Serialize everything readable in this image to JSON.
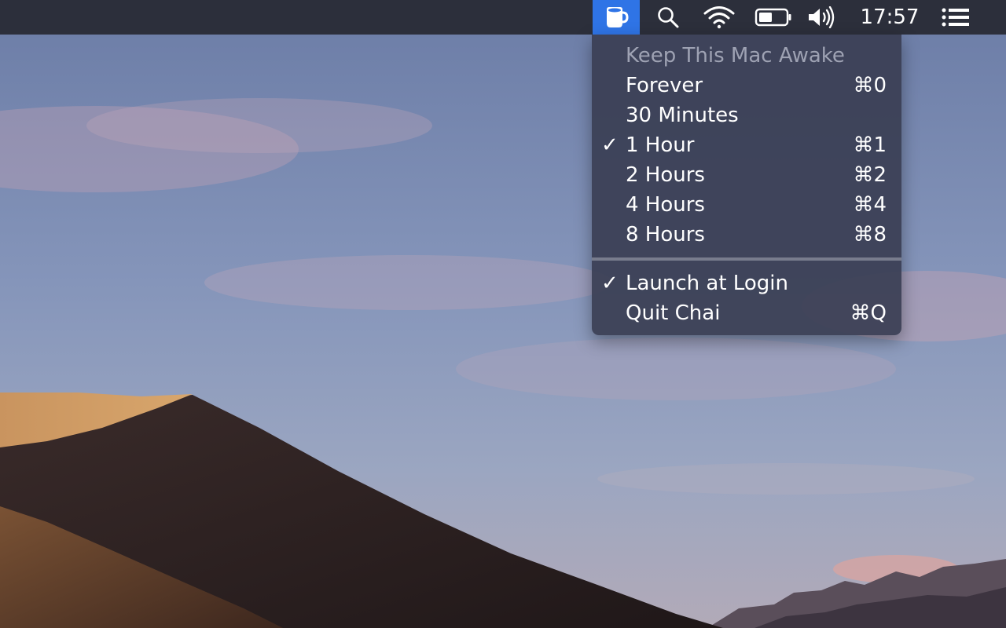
{
  "menubar": {
    "app_icon": "coffee-cup-icon",
    "spotlight_icon": "magnifying-glass-icon",
    "wifi_icon": "wifi-icon",
    "battery_icon": "battery-icon",
    "volume_icon": "speaker-icon",
    "clock": "17:57",
    "notification_icon": "list-icon",
    "active_color": "#2f74e6",
    "bar_color": "#2c2f3b"
  },
  "menu": {
    "header": "Keep This Mac Awake",
    "items": [
      {
        "label": "Forever",
        "shortcut": "⌘0",
        "checked": false,
        "check": ""
      },
      {
        "label": "30 Minutes",
        "shortcut": "",
        "checked": false,
        "check": ""
      },
      {
        "label": "1 Hour",
        "shortcut": "⌘1",
        "checked": true,
        "check": "✓"
      },
      {
        "label": "2 Hours",
        "shortcut": "⌘2",
        "checked": false,
        "check": ""
      },
      {
        "label": "4 Hours",
        "shortcut": "⌘4",
        "checked": false,
        "check": ""
      },
      {
        "label": "8 Hours",
        "shortcut": "⌘8",
        "checked": false,
        "check": ""
      }
    ],
    "footer_items": [
      {
        "label": "Launch at Login",
        "shortcut": "",
        "checked": true,
        "check": "✓"
      },
      {
        "label": "Quit Chai",
        "shortcut": "⌘Q",
        "checked": false,
        "check": ""
      }
    ]
  }
}
